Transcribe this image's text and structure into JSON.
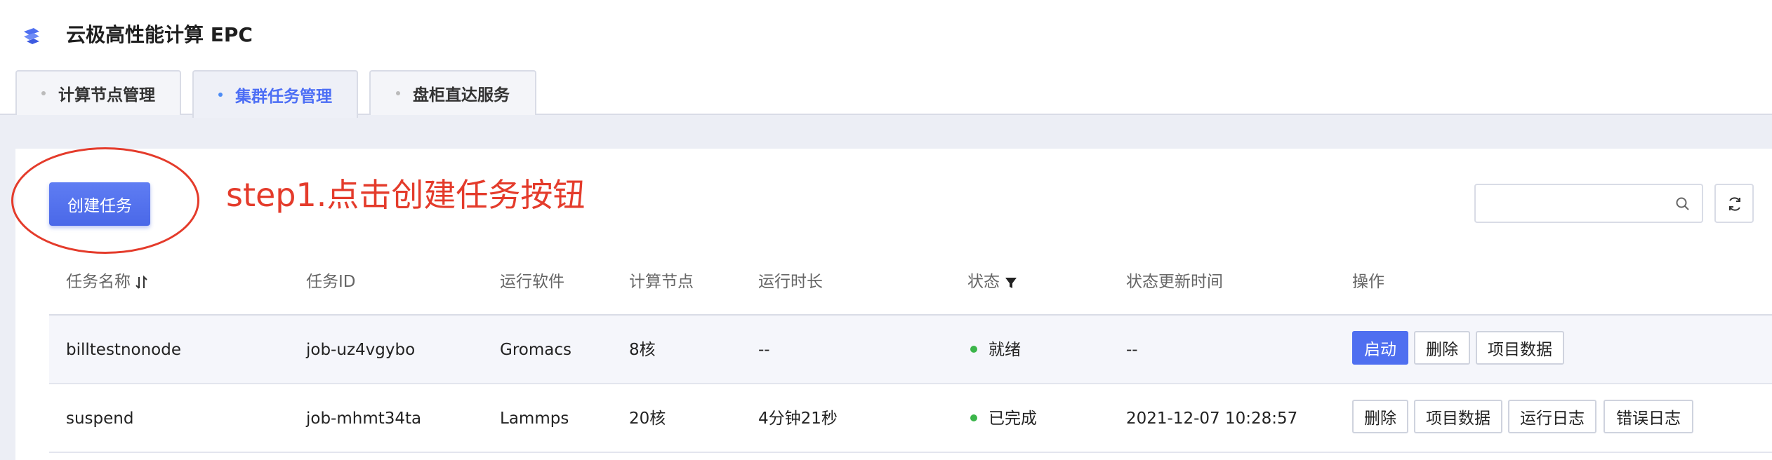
{
  "app": {
    "title": "云极高性能计算 EPC"
  },
  "tabs": [
    {
      "label": "计算节点管理"
    },
    {
      "label": "集群任务管理"
    },
    {
      "label": "盘柜直达服务"
    }
  ],
  "toolbar": {
    "create_label": "创建任务",
    "annotation": "step1.点击创建任务按钮",
    "search_placeholder": ""
  },
  "table": {
    "headers": [
      "任务名称",
      "任务ID",
      "运行软件",
      "计算节点",
      "运行时长",
      "状态",
      "状态更新时间",
      "操作"
    ],
    "rows": [
      {
        "name": "billtestnonode",
        "id": "job-uz4vgybo",
        "software": "Gromacs",
        "nodes": "8核",
        "duration": "--",
        "status": "就绪",
        "updated": "--",
        "actions": [
          "启动",
          "删除",
          "项目数据"
        ]
      },
      {
        "name": "suspend",
        "id": "job-mhmt34ta",
        "software": "Lammps",
        "nodes": "20核",
        "duration": "4分钟21秒",
        "status": "已完成",
        "updated": "2021-12-07 10:28:57",
        "actions": [
          "删除",
          "项目数据",
          "运行日志",
          "错误日志"
        ]
      }
    ]
  },
  "colors": {
    "accent": "#4f6ff0",
    "annotation": "#e43b2b",
    "status_ok": "#3bb54a"
  }
}
